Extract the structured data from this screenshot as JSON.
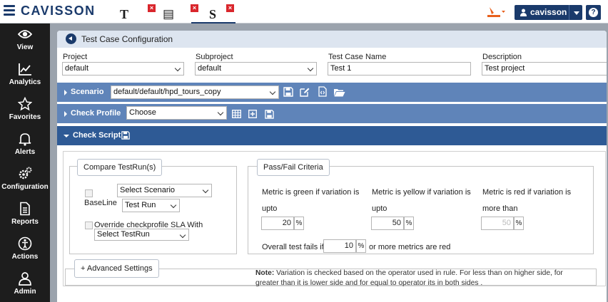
{
  "app": {
    "logo": "CAVISSON",
    "user": "cavisson"
  },
  "tabs": [
    {
      "glyph": "T",
      "name": "text-tab"
    },
    {
      "glyph": "▤",
      "name": "doc-tab"
    },
    {
      "glyph": "S",
      "name": "script-tab"
    }
  ],
  "sidebar": [
    {
      "label": "View",
      "icon": "eye-icon"
    },
    {
      "label": "Analytics",
      "icon": "chart-line-icon"
    },
    {
      "label": "Favorites",
      "icon": "star-icon"
    },
    {
      "label": "Alerts",
      "icon": "bell-icon"
    },
    {
      "label": "Configuration",
      "icon": "gears-icon"
    },
    {
      "label": "Reports",
      "icon": "report-icon"
    },
    {
      "label": "Actions",
      "icon": "actions-icon"
    },
    {
      "label": "Admin",
      "icon": "user-icon"
    }
  ],
  "page": {
    "title": "Test Case Configuration"
  },
  "fields": {
    "project": {
      "label": "Project",
      "value": "default"
    },
    "subproject": {
      "label": "Subproject",
      "value": "default"
    },
    "testcase": {
      "label": "Test Case Name",
      "value": "Test 1"
    },
    "description": {
      "label": "Description",
      "value": "Test project"
    }
  },
  "scenario": {
    "label": "Scenario",
    "value": "default/default/hpd_tours_copy"
  },
  "checkprofile": {
    "label": "Check Profile",
    "value": "Choose"
  },
  "checkscript": {
    "label": "Check Script"
  },
  "compare": {
    "legend": "Compare TestRun(s)",
    "select_scenario": "Select Scenario",
    "baseline": "BaseLine",
    "testrun": "Test Run",
    "override": "Override checkprofile SLA With",
    "select_testrun": "Select TestRun"
  },
  "criteria": {
    "legend": "Pass/Fail Criteria",
    "green_line1": "Metric is green if variation is",
    "green_line2": "upto",
    "green_value": "20",
    "yellow_line1": "Metric is yellow if variation is",
    "yellow_line2": "upto",
    "yellow_value": "50",
    "red_line1": "Metric is red if variation is",
    "red_line2": "more than",
    "red_value": "50",
    "pct": "%",
    "overall_prefix": "Overall test fails if",
    "overall_value": "10",
    "overall_suffix": "or more metrics are red"
  },
  "advanced": {
    "label": "+ Advanced Settings"
  },
  "note": {
    "prefix": "Note:",
    "line1": " Variation is checked based on the operator used in rule. For less than on higher side, for",
    "line2": "greater than it is lower side and for equal to operator its in both sides ."
  },
  "colors": {
    "navy": "#1a3a6b",
    "bar": "#5f84b9",
    "bar_active": "#2e5a95",
    "sidebar": "#1d1d1d",
    "close": "#d9262c"
  }
}
